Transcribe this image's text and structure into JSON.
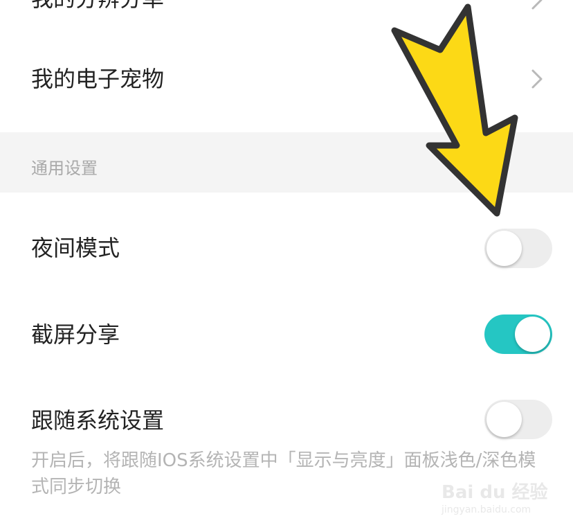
{
  "list_top": {
    "partial_item_label": "我的分辨分单"
  },
  "list": {
    "pet_label": "我的电子宠物"
  },
  "general_section": {
    "title": "通用设置",
    "night_mode": {
      "label": "夜间模式",
      "enabled": false
    },
    "screenshot_share": {
      "label": "截屏分享",
      "enabled": true
    },
    "follow_system": {
      "label": "跟随系统设置",
      "enabled": false,
      "description": "开启后，将跟随IOS系统设置中「显示与亮度」面板浅色/深色模式同步切换"
    }
  },
  "colors": {
    "toggle_on": "#25c6c3",
    "toggle_off": "#ededed",
    "annotation_arrow": "#fcd916"
  },
  "watermark": {
    "brand": "Bai du 经验",
    "url": "jingyan.baidu.com"
  }
}
